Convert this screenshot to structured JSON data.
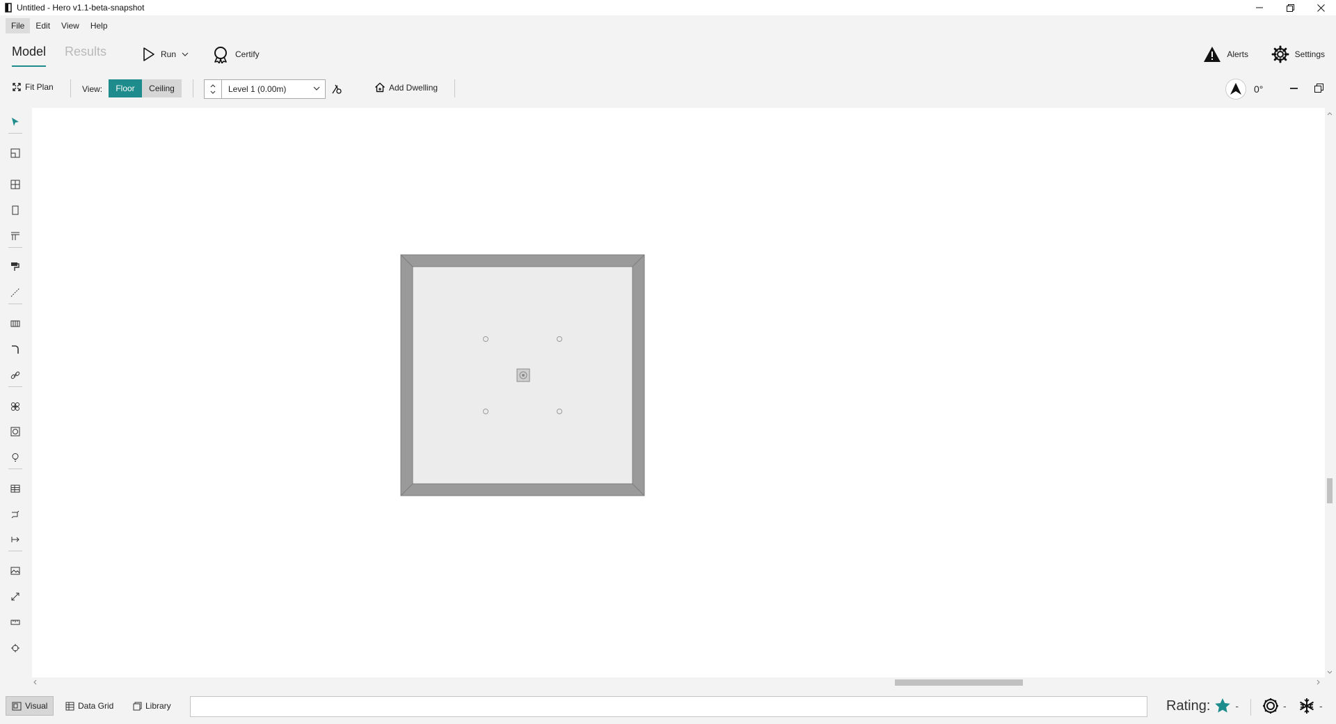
{
  "window": {
    "title": "Untitled - Hero v1.1-beta-snapshot"
  },
  "menu": {
    "items": [
      "File",
      "Edit",
      "View",
      "Help"
    ]
  },
  "toolbar": {
    "tab_model": "Model",
    "tab_results": "Results",
    "run_label": "Run",
    "certify_label": "Certify",
    "alerts_label": "Alerts",
    "settings_label": "Settings"
  },
  "subtoolbar": {
    "fit_plan_label": "Fit Plan",
    "view_label": "View:",
    "floor_label": "Floor",
    "ceiling_label": "Ceiling",
    "level_value": "Level 1 (0.00m)",
    "add_dwelling_label": "Add Dwelling",
    "rotation_angle": "0°"
  },
  "left_tools": [
    "select-tool-icon",
    "room-tool-icon",
    "zone-tool-icon",
    "wall-tool-icon",
    "window-tool-icon",
    "paint-tool-icon",
    "line-tool-icon",
    "grid-tool-icon",
    "draw-tool-icon",
    "link-tool-icon",
    "fan-tool-icon",
    "vent-tool-icon",
    "light-tool-icon",
    "table-tool-icon",
    "pipe-tool-icon",
    "exit-tool-icon",
    "image-tool-icon",
    "resize-tool-icon",
    "measure-tool-icon",
    "origin-tool-icon"
  ],
  "bottom": {
    "visual_label": "Visual",
    "data_grid_label": "Data Grid",
    "library_label": "Library",
    "rating_label": "Rating:",
    "rating_value": "-",
    "heating_value": "-",
    "cooling_value": "-"
  },
  "colors": {
    "accent": "#1e8c8c",
    "room_wall": "#9a9a9a",
    "room_floor": "#ececec",
    "inactive_tab": "#b9b9b9"
  }
}
